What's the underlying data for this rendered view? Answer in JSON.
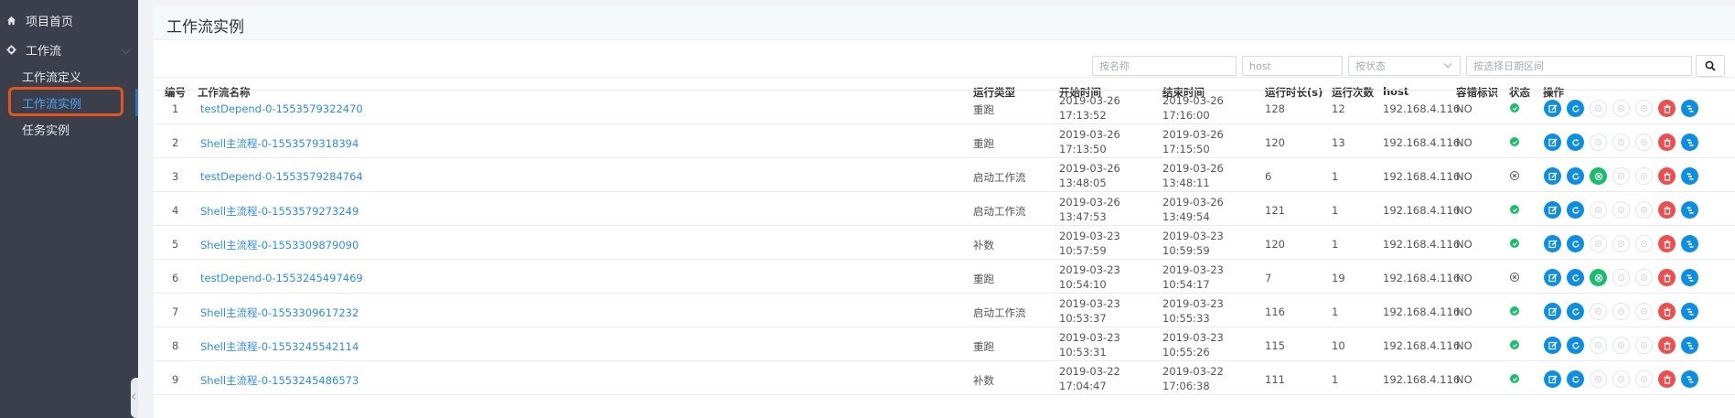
{
  "sidebar": {
    "items": [
      {
        "label": "项目首页",
        "icon": "home-icon"
      },
      {
        "label": "工作流",
        "icon": "gear-icon"
      }
    ],
    "sub_items": [
      {
        "label": "工作流定义"
      },
      {
        "label": "工作流实例",
        "active": true
      },
      {
        "label": "任务实例"
      }
    ]
  },
  "page": {
    "title": "工作流实例"
  },
  "filters": {
    "name_placeholder": "按名称",
    "host_placeholder": "host",
    "status_placeholder": "按状态",
    "date_placeholder": "按选择日期区间"
  },
  "table": {
    "headers": [
      "编号",
      "工作流名称",
      "运行类型",
      "开始时间",
      "结束时间",
      "运行时长(s)",
      "运行次数",
      "host",
      "容错标识",
      "状态",
      "操作"
    ],
    "rows": [
      {
        "id": "1",
        "name": "testDepend-0-1553579322470",
        "type": "重跑",
        "start_date": "2019-03-26",
        "start_time": "17:13:52",
        "end_date": "2019-03-26",
        "end_time": "17:16:00",
        "duration": "128",
        "runs": "12",
        "host": "192.168.4.116",
        "ft": "NO",
        "status": "success",
        "ops": [
          "edit",
          "rerun",
          "dis",
          "dis",
          "dis",
          "delete",
          "gantt"
        ]
      },
      {
        "id": "2",
        "name": "Shell主流程-0-1553579318394",
        "type": "重跑",
        "start_date": "2019-03-26",
        "start_time": "17:13:50",
        "end_date": "2019-03-26",
        "end_time": "17:15:50",
        "duration": "120",
        "runs": "13",
        "host": "192.168.4.116",
        "ft": "NO",
        "status": "success",
        "ops": [
          "edit",
          "rerun",
          "dis",
          "dis",
          "dis",
          "delete",
          "gantt"
        ]
      },
      {
        "id": "3",
        "name": "testDepend-0-1553579284764",
        "type": "启动工作流",
        "start_date": "2019-03-26",
        "start_time": "13:48:05",
        "end_date": "2019-03-26",
        "end_time": "13:48:11",
        "duration": "6",
        "runs": "1",
        "host": "192.168.4.116",
        "ft": "NO",
        "status": "failed",
        "ops": [
          "edit",
          "rerun",
          "recover",
          "dis",
          "dis",
          "delete",
          "gantt"
        ]
      },
      {
        "id": "4",
        "name": "Shell主流程-0-1553579273249",
        "type": "启动工作流",
        "start_date": "2019-03-26",
        "start_time": "13:47:53",
        "end_date": "2019-03-26",
        "end_time": "13:49:54",
        "duration": "121",
        "runs": "1",
        "host": "192.168.4.116",
        "ft": "NO",
        "status": "success",
        "ops": [
          "edit",
          "rerun",
          "dis",
          "dis",
          "dis",
          "delete",
          "gantt"
        ]
      },
      {
        "id": "5",
        "name": "Shell主流程-0-1553309879090",
        "type": "补数",
        "start_date": "2019-03-23",
        "start_time": "10:57:59",
        "end_date": "2019-03-23",
        "end_time": "10:59:59",
        "duration": "120",
        "runs": "1",
        "host": "192.168.4.116",
        "ft": "NO",
        "status": "success",
        "ops": [
          "edit",
          "rerun",
          "dis",
          "dis",
          "dis",
          "delete",
          "gantt"
        ]
      },
      {
        "id": "6",
        "name": "testDepend-0-1553245497469",
        "type": "重跑",
        "start_date": "2019-03-23",
        "start_time": "10:54:10",
        "end_date": "2019-03-23",
        "end_time": "10:54:17",
        "duration": "7",
        "runs": "19",
        "host": "192.168.4.116",
        "ft": "NO",
        "status": "failed",
        "ops": [
          "edit",
          "rerun",
          "recover",
          "dis",
          "dis",
          "delete",
          "gantt"
        ]
      },
      {
        "id": "7",
        "name": "Shell主流程-0-1553309617232",
        "type": "启动工作流",
        "start_date": "2019-03-23",
        "start_time": "10:53:37",
        "end_date": "2019-03-23",
        "end_time": "10:55:33",
        "duration": "116",
        "runs": "1",
        "host": "192.168.4.116",
        "ft": "NO",
        "status": "success",
        "ops": [
          "edit",
          "rerun",
          "dis",
          "dis",
          "dis",
          "delete",
          "gantt"
        ]
      },
      {
        "id": "8",
        "name": "Shell主流程-0-1553245542114",
        "type": "重跑",
        "start_date": "2019-03-23",
        "start_time": "10:53:31",
        "end_date": "2019-03-23",
        "end_time": "10:55:26",
        "duration": "115",
        "runs": "10",
        "host": "192.168.4.116",
        "ft": "NO",
        "status": "success",
        "ops": [
          "edit",
          "rerun",
          "dis",
          "dis",
          "dis",
          "delete",
          "gantt"
        ]
      },
      {
        "id": "9",
        "name": "Shell主流程-0-1553245486573",
        "type": "补数",
        "start_date": "2019-03-22",
        "start_time": "17:04:47",
        "end_date": "2019-03-22",
        "end_time": "17:06:38",
        "duration": "111",
        "runs": "1",
        "host": "192.168.4.116",
        "ft": "NO",
        "status": "success",
        "ops": [
          "edit",
          "rerun",
          "dis",
          "dis",
          "dis",
          "delete",
          "gantt"
        ]
      }
    ]
  },
  "colors": {
    "sidebar_bg": "#3a3f4b",
    "accent_blue": "#0e8ee3",
    "link_blue": "#2d8cf0",
    "danger_red": "#ed4f4f",
    "success_green": "#19be6b",
    "highlight_orange": "#e8541d"
  }
}
